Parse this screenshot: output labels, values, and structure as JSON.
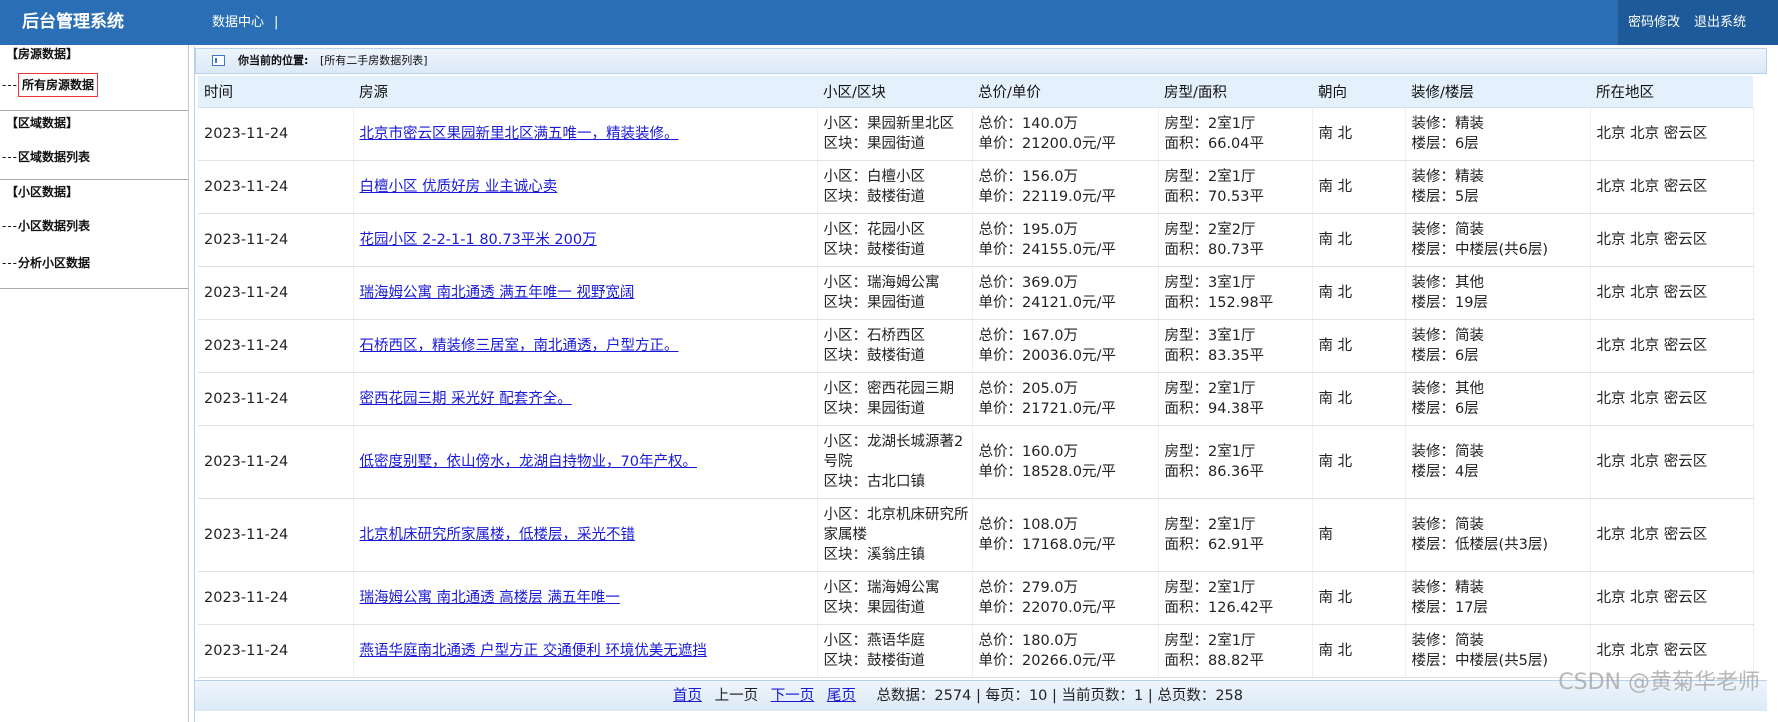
{
  "header": {
    "app_title": "后台管理系统",
    "nav_label": "数据中心",
    "nav_sep": "|",
    "change_password": "密码修改",
    "logout": "退出系统"
  },
  "sidebar": {
    "group1_title": "【房源数据】",
    "item_all_listings": "所有房源数据",
    "group2_title": "【区域数据】",
    "item_region_list": "区域数据列表",
    "group3_title": "【小区数据】",
    "item_community_list": "小区数据列表",
    "item_analyze_community": "分析小区数据",
    "dash": "---"
  },
  "location": {
    "label": "你当前的位置:",
    "value": "[所有二手房数据列表]"
  },
  "table": {
    "headers": [
      "时间",
      "房源",
      "小区/区块",
      "总价/单价",
      "房型/面积",
      "朝向",
      "装修/楼层",
      "所在地区"
    ],
    "rows": [
      {
        "date": "2023-11-24",
        "title": "北京市密云区果园新里北区满五唯一，精装装修。",
        "community": "小区：果园新里北区",
        "block": "区块：果园街道",
        "total": "总价：140.0万",
        "unit": "单价：21200.0元/平",
        "layout": "房型：2室1厅",
        "area": "面积：66.04平",
        "orientation": "南 北",
        "decoration": "装修：精装",
        "floor": "楼层：6层",
        "region": "北京 北京 密云区"
      },
      {
        "date": "2023-11-24",
        "title": "白檀小区 优质好房 业主诚心卖",
        "community": "小区：白檀小区",
        "block": "区块：鼓楼街道",
        "total": "总价：156.0万",
        "unit": "单价：22119.0元/平",
        "layout": "房型：2室1厅",
        "area": "面积：70.53平",
        "orientation": "南 北",
        "decoration": "装修：精装",
        "floor": "楼层：5层",
        "region": "北京 北京 密云区"
      },
      {
        "date": "2023-11-24",
        "title": "花园小区 2-2-1-1 80.73平米 200万",
        "community": "小区：花园小区",
        "block": "区块：鼓楼街道",
        "total": "总价：195.0万",
        "unit": "单价：24155.0元/平",
        "layout": "房型：2室2厅",
        "area": "面积：80.73平",
        "orientation": "南 北",
        "decoration": "装修：简装",
        "floor": "楼层：中楼层(共6层)",
        "region": "北京 北京 密云区"
      },
      {
        "date": "2023-11-24",
        "title": "瑞海姆公寓 南北通透 满五年唯一 视野宽阔",
        "community": "小区：瑞海姆公寓",
        "block": "区块：果园街道",
        "total": "总价：369.0万",
        "unit": "单价：24121.0元/平",
        "layout": "房型：3室1厅",
        "area": "面积：152.98平",
        "orientation": "南 北",
        "decoration": "装修：其他",
        "floor": "楼层：19层",
        "region": "北京 北京 密云区"
      },
      {
        "date": "2023-11-24",
        "title": "石桥西区，精装修三居室，南北通透，户型方正。",
        "community": "小区：石桥西区",
        "block": "区块：鼓楼街道",
        "total": "总价：167.0万",
        "unit": "单价：20036.0元/平",
        "layout": "房型：3室1厅",
        "area": "面积：83.35平",
        "orientation": "南 北",
        "decoration": "装修：简装",
        "floor": "楼层：6层",
        "region": "北京 北京 密云区"
      },
      {
        "date": "2023-11-24",
        "title": "密西花园三期 采光好 配套齐全。",
        "community": "小区：密西花园三期",
        "block": "区块：果园街道",
        "total": "总价：205.0万",
        "unit": "单价：21721.0元/平",
        "layout": "房型：2室1厅",
        "area": "面积：94.38平",
        "orientation": "南 北",
        "decoration": "装修：其他",
        "floor": "楼层：6层",
        "region": "北京 北京 密云区"
      },
      {
        "date": "2023-11-24",
        "title": "低密度别墅，依山傍水，龙湖自持物业，70年产权。",
        "community": "小区：龙湖长城源著2号院",
        "block": "区块：古北口镇",
        "total": "总价：160.0万",
        "unit": "单价：18528.0元/平",
        "layout": "房型：2室1厅",
        "area": "面积：86.36平",
        "orientation": "南 北",
        "decoration": "装修：简装",
        "floor": "楼层：4层",
        "region": "北京 北京 密云区"
      },
      {
        "date": "2023-11-24",
        "title": "北京机床研究所家属楼，低楼层，采光不错",
        "community": "小区：北京机床研究所家属楼",
        "block": "区块：溪翁庄镇",
        "total": "总价：108.0万",
        "unit": "单价：17168.0元/平",
        "layout": "房型：2室1厅",
        "area": "面积：62.91平",
        "orientation": "南",
        "decoration": "装修：简装",
        "floor": "楼层：低楼层(共3层)",
        "region": "北京 北京 密云区"
      },
      {
        "date": "2023-11-24",
        "title": "瑞海姆公寓 南北通透 高楼层 满五年唯一",
        "community": "小区：瑞海姆公寓",
        "block": "区块：果园街道",
        "total": "总价：279.0万",
        "unit": "单价：22070.0元/平",
        "layout": "房型：2室1厅",
        "area": "面积：126.42平",
        "orientation": "南 北",
        "decoration": "装修：精装",
        "floor": "楼层：17层",
        "region": "北京 北京 密云区"
      },
      {
        "date": "2023-11-24",
        "title": "燕语华庭南北通透 户型方正 交通便利 环境优美无遮挡",
        "community": "小区：燕语华庭",
        "block": "区块：鼓楼街道",
        "total": "总价：180.0万",
        "unit": "单价：20266.0元/平",
        "layout": "房型：2室1厅",
        "area": "面积：88.82平",
        "orientation": "南 北",
        "decoration": "装修：简装",
        "floor": "楼层：中楼层(共5层)",
        "region": "北京 北京 密云区"
      }
    ]
  },
  "pager": {
    "first": "首页",
    "prev": "上一页",
    "next": "下一页",
    "last": "尾页",
    "summary": "总数据：2574 | 每页：10 | 当前页数：1 | 总页数：258"
  },
  "watermark": "CSDN @黄菊华老师",
  "colors": {
    "header_bg": "#2a6fb5",
    "header_right_bg": "#1e5a99",
    "link": "#1a1ad6",
    "table_header_bg": "#e4f0fb"
  }
}
